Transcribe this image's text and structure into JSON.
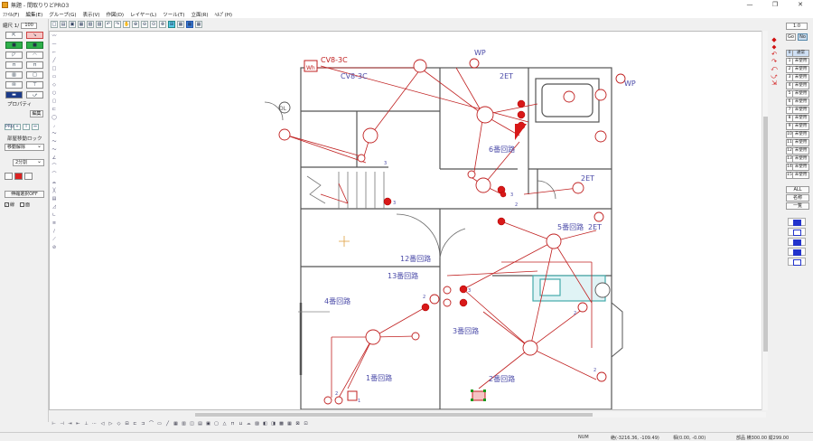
{
  "window": {
    "title": "無題 - 間取りりどPRO3",
    "controls": [
      "—",
      "❐",
      "✕"
    ]
  },
  "menu": [
    "ﾌｧｲﾙ(F)",
    "編集(E)",
    "グループ(G)",
    "表示(V)",
    "作図(D)",
    "レイヤー(L)",
    "ツール(T)",
    "立面(R)",
    "ﾍﾙﾌﾟ(H)"
  ],
  "toolbar": [
    "□",
    "▤",
    "▣",
    "▦",
    "▧",
    "▨",
    "↶",
    "↷",
    "✋",
    "⊕",
    "⊖",
    "⊙",
    "⊗",
    "⊞",
    "▦",
    "▦",
    "▦"
  ],
  "left_panel": {
    "scale_label": "縮尺 1/",
    "scale_value": "100",
    "tools": [
      "⇱",
      "↘",
      "■",
      "■",
      "◸",
      "◠",
      "⊓",
      "⊓",
      "▥",
      "□",
      "✉",
      "⊤",
      "▬",
      "⤻"
    ],
    "property_label": "プロパティ",
    "edit_button": "編集",
    "mini_tools": [
      "PRO",
      "+",
      "I",
      "↔"
    ],
    "room_lock_label": "部屋移動ロック",
    "move_mode": "移動解除",
    "split_value": "2分割",
    "tape_button": "伸縮選択OFF",
    "check_a": "線",
    "check_b": "面"
  },
  "side_tools": [
    "〰",
    "—",
    "⌐",
    "╱",
    "□",
    "▭",
    "◇",
    "○",
    "▢",
    "⊏",
    "◯",
    "◞",
    "〜",
    "〜",
    "〜",
    "∠",
    "⌒",
    "⌒",
    "⌓",
    "╳",
    "▤",
    "◿",
    "∟",
    "≡",
    "∕",
    "⟋",
    "⊘"
  ],
  "canvas": {
    "labels": {
      "cv1": "CV8-3C",
      "cv2": "CV8-3C",
      "wh": "Wh",
      "dl": "DL",
      "wp1": "WP",
      "wp2": "WP",
      "et1": "2ET",
      "et2": "2ET",
      "et3": "2ET",
      "c6": "6番回路",
      "c5": "5番回路",
      "c12": "12番回路",
      "c13": "13番回路",
      "c4": "4番回路",
      "c3": "3番回路",
      "c1": "1番回路",
      "c2": "2番回路",
      "n3a": "3",
      "n3b": "3",
      "n3c": "3",
      "n3d": "3",
      "n2a": "2",
      "n2b": "2",
      "n2c": "2",
      "n2d": "2",
      "n2e": "2",
      "n1": "1"
    }
  },
  "arrows": [
    "◆",
    "⬥",
    "↶",
    "↷",
    "⤺",
    "⤻",
    "⇲"
  ],
  "right_panel": {
    "top_value": "1:0",
    "go_label": "Go",
    "no_label": "No",
    "layers": [
      {
        "num": "0",
        "name": "通常"
      },
      {
        "num": "1",
        "name": "未使用"
      },
      {
        "num": "2",
        "name": "未使用"
      },
      {
        "num": "3",
        "name": "未使用"
      },
      {
        "num": "4",
        "name": "未使用"
      },
      {
        "num": "5",
        "name": "未使用"
      },
      {
        "num": "6",
        "name": "未使用"
      },
      {
        "num": "7",
        "name": "未使用"
      },
      {
        "num": "8",
        "name": "未使用"
      },
      {
        "num": "9",
        "name": "未使用"
      },
      {
        "num": "10",
        "name": "未使用"
      },
      {
        "num": "11",
        "name": "未使用"
      },
      {
        "num": "12",
        "name": "未使用"
      },
      {
        "num": "13",
        "name": "未使用"
      },
      {
        "num": "14",
        "name": "未使用"
      },
      {
        "num": "15",
        "name": "未使用"
      }
    ],
    "all_label": "ALL",
    "name_label": "名称",
    "list_label": "一覧"
  },
  "bottom_tools": [
    "⊢",
    "⊣",
    "⇥",
    "⇤",
    "⊥",
    "⋯",
    "◁",
    "▷",
    "◇",
    "⊟",
    "⊏",
    "⊐",
    "⌒",
    "▭",
    "╱",
    "▦",
    "▥",
    "◫",
    "▤",
    "▣",
    "▢",
    "△",
    "⊓",
    "⊔",
    "⌓",
    "▨",
    "◧",
    "◨",
    "▩",
    "▦",
    "⊠",
    "⊡"
  ],
  "status": {
    "num": "NUM",
    "coords": "絶(-3216.36, -109.49)",
    "rel": "相(0.00, -0.00)",
    "size": "部品 横300.00 縦299.00"
  }
}
